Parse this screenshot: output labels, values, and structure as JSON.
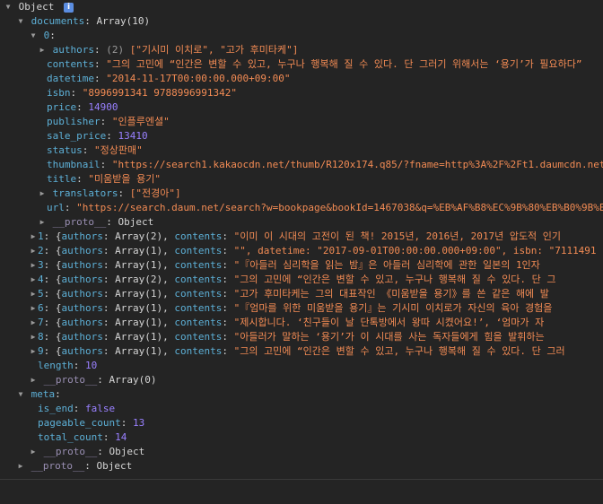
{
  "root": {
    "label": "Object",
    "info_badge": "i"
  },
  "documents": {
    "key": "documents",
    "summary": "Array(10)"
  },
  "doc0": {
    "index": "0",
    "authors": {
      "key": "authors",
      "count": "(2)",
      "value": "[\"기시미 이치로\", \"고가 후미타케\"]"
    },
    "contents": {
      "key": "contents",
      "value": "\"그의 고민에 “인간은 변할 수 있고, 누구나 행복해 질 수 있다. 단 그러기 위해서는 ‘용기’가 필요하다”"
    },
    "datetime": {
      "key": "datetime",
      "value": "\"2014-11-17T00:00:00.000+09:00\""
    },
    "isbn": {
      "key": "isbn",
      "value": "\"8996991341 9788996991342\""
    },
    "price": {
      "key": "price",
      "value": "14900"
    },
    "publisher": {
      "key": "publisher",
      "value": "\"인플루엔셜\""
    },
    "sale_price": {
      "key": "sale_price",
      "value": "13410"
    },
    "status": {
      "key": "status",
      "value": "\"정상판매\""
    },
    "thumbnail": {
      "key": "thumbnail",
      "value": "\"https://search1.kakaocdn.net/thumb/R120x174.q85/?fname=http%3A%2F%2Ft1.daumcdn.net"
    },
    "title": {
      "key": "title",
      "value": "\"미움받을 용기\""
    },
    "translators": {
      "key": "translators",
      "value": "[\"전경아\"]"
    },
    "url": {
      "key": "url",
      "value": "\"https://search.daum.net/search?w=bookpage&bookId=1467038&q=%EB%AF%B8%EC%9B%80%EB%B0%9B%EC"
    },
    "proto": {
      "key": "__proto__",
      "value": "Object"
    }
  },
  "docs": [
    {
      "index": "1",
      "authors": "Array(2)",
      "contents": "\"이미 이 시대의 고전이 된 책! 2015년, 2016년, 2017년 압도적 인기"
    },
    {
      "index": "2",
      "authors": "Array(1)",
      "contents": "\"\", datetime: \"2017-09-01T00:00:00.000+09:00\", isbn: \"7111491"
    },
    {
      "index": "3",
      "authors": "Array(1)",
      "contents": "\"『아들러 심리학을 읽는 밤』은 아들러 심리학에 관한 일본의 1인자"
    },
    {
      "index": "4",
      "authors": "Array(2)",
      "contents": "\"그의 고민에 “인간은 변할 수 있고, 누구나 행복해 질 수 있다. 단 그"
    },
    {
      "index": "5",
      "authors": "Array(1)",
      "contents": "\"고가 후미타케는 그의 대표작인 《미움받을 용기》를 쓴 같은 해에 발"
    },
    {
      "index": "6",
      "authors": "Array(1)",
      "contents": "\"『엄마를 위한 미움받을 용기』는 기시미 이치로가 자신의 육아 경험을"
    },
    {
      "index": "7",
      "authors": "Array(1)",
      "contents": "\"제시합니다.  ‘친구들이 날 단톡방에서 왕따 시켰어요!’, ‘엄마가 자"
    },
    {
      "index": "8",
      "authors": "Array(1)",
      "contents": "\"아들러가 말하는 ‘용기’가 이 시대를 사는 독자들에게 힘을 발휘하는"
    },
    {
      "index": "9",
      "authors": "Array(1)",
      "contents": "\"그의 고민에 “인간은 변할 수 있고, 누구나 행복해 질 수 있다. 단 그러"
    }
  ],
  "docs_common": {
    "authors_key": "authors",
    "contents_key": "contents",
    "open": "{",
    "sep": ", ",
    "ellipsis": "…"
  },
  "length": {
    "key": "length",
    "value": "10"
  },
  "documents_proto": {
    "key": "__proto__",
    "value": "Array(0)"
  },
  "meta": {
    "key": "meta",
    "is_end": {
      "key": "is_end",
      "value": "false"
    },
    "pageable_count": {
      "key": "pageable_count",
      "value": "13"
    },
    "total_count": {
      "key": "total_count",
      "value": "14"
    },
    "proto": {
      "key": "__proto__",
      "value": "Object"
    }
  },
  "root_proto": {
    "key": "__proto__",
    "value": "Object"
  },
  "colors": {
    "background": "#242424",
    "key": "#5db0d7",
    "string": "#f28b54",
    "number": "#9980ff",
    "text": "#d5d5d5"
  },
  "icons": {
    "expanded": "triangle-down-icon",
    "collapsed": "triangle-right-icon"
  }
}
